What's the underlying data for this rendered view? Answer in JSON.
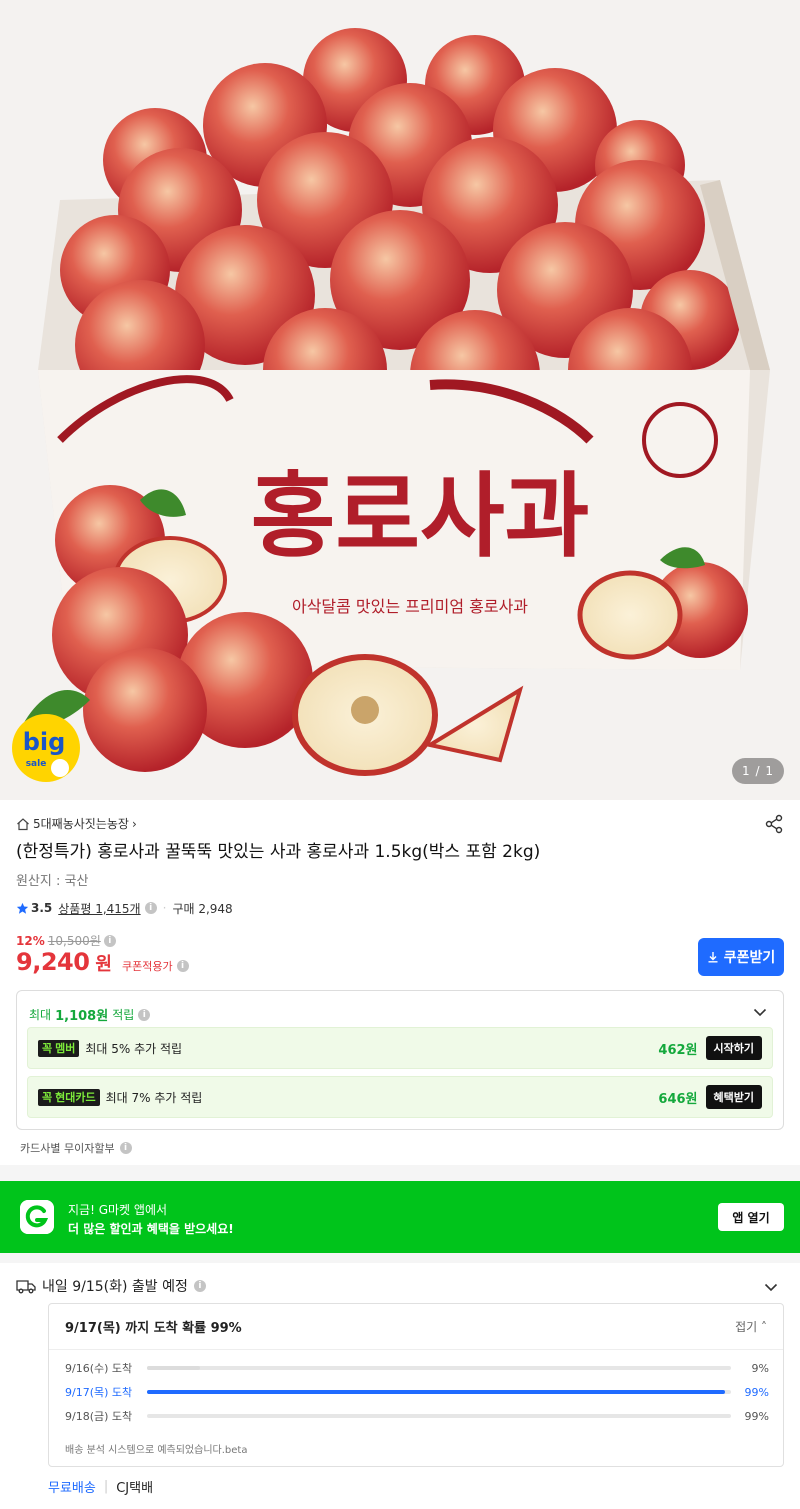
{
  "hero": {
    "counter": "1 / 1",
    "box_text": "홍로사과",
    "box_subtext": "아삭달콤 맛있는 프리미엄 홍로사과",
    "badge_big": "big",
    "badge_sale": "sale"
  },
  "seller": {
    "name": "5대째농사짓는농장"
  },
  "product": {
    "title": "(한정특가) 홍로사과 꿀뚝뚝 맛있는 사과 홍로사과 1.5kg(박스 포함 2kg)",
    "origin": "원산지 : 국산",
    "rating": "3.5",
    "review_label": "상품평 1,415개",
    "purchase_count": "구매 2,948"
  },
  "price": {
    "discount_pct": "12%",
    "original": "10,500원",
    "current": "9,240",
    "unit": "원",
    "coupon_applied": "쿠폰적용가",
    "coupon_button": "쿠폰받기"
  },
  "reward": {
    "prefix": "최대",
    "amount": "1,108원",
    "suffix": "적립",
    "rows": [
      {
        "tag": "멤버",
        "desc": "최대 5% 추가 적립",
        "amount": "462원",
        "action": "시작하기"
      },
      {
        "tag": "현대카드",
        "desc": "최대 7% 추가 적립",
        "amount": "646원",
        "action": "혜택받기"
      }
    ],
    "installment": "카드사별 무이자할부"
  },
  "app_banner": {
    "line1": "지금! G마켓 앱에서",
    "line2": "더 많은 할인과 혜택을 받으세요!",
    "button": "앱 열기"
  },
  "shipping": {
    "headline": "내일 9/15(화) 출발 예정",
    "summary": "9/17(목) 까지 도착 확률 99%",
    "fold": "접기",
    "rows": [
      {
        "date": "9/16(수) 도착",
        "pct": "9%",
        "value": 9
      },
      {
        "date": "9/17(목) 도착",
        "pct": "99%",
        "value": 99
      },
      {
        "date": "9/18(금) 도착",
        "pct": "99%",
        "value": 0
      }
    ],
    "note": "배송 분석 시스템으로 예측되었습니다.beta",
    "free": "무료배송",
    "carrier": "CJ택배"
  },
  "colors": {
    "price_red": "#e4353b",
    "accent_blue": "#1f6bff",
    "gmarket_green": "#00c41b",
    "reward_green": "#14a83c"
  }
}
